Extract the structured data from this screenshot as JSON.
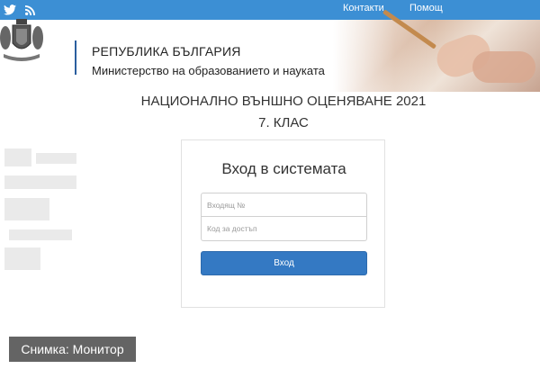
{
  "topbar": {
    "icons": [
      "twitter-icon",
      "rss-icon"
    ],
    "links": {
      "contacts": "Контакти",
      "help": "Помощ"
    },
    "color": "#3c8fd4"
  },
  "header": {
    "title": "РЕПУБЛИКА БЪЛГАРИЯ",
    "subtitle": "Министерство на образованието и науката"
  },
  "exam": {
    "title": "НАЦИОНАЛНО ВЪНШНО ОЦЕНЯВАНЕ 2021",
    "grade": "7. КЛАС"
  },
  "login": {
    "heading": "Вход в системата",
    "incoming_placeholder": "Входящ №",
    "access_code_placeholder": "Код за достъп",
    "submit_label": "Вход",
    "button_color": "#3479c3"
  },
  "credit": "Снимка: Монитор"
}
